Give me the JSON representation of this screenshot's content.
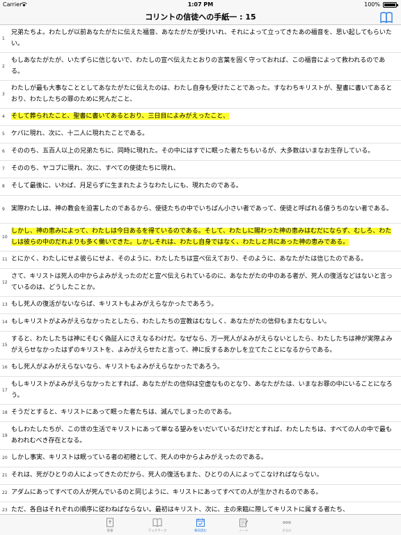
{
  "status": {
    "carrier": "Carrier",
    "time": "1:07 PM",
    "battery": "100%"
  },
  "header": {
    "title": "コリントの信徒への手紙一 : 15"
  },
  "verses": [
    {
      "n": "1",
      "text": "兄弟たちよ。わたしが以前あなたがたに伝えた福音、あなたがたが受けいれ、それによって立ってきたあの福音を、思い起してもらいたい。",
      "highlight": false
    },
    {
      "n": "2",
      "text": "もしあなたがたが、いたずらに信じないで、わたしの宣べ伝えたとおりの言葉を固く守っておれば、この福音によって救われるのである。",
      "highlight": false
    },
    {
      "n": "3",
      "text": "わたしが最も大事なこととしてあなたがたに伝えたのは、わたし自身も受けたことであった。すなわちキリストが、聖書に書いてあるとおり、わたしたちの罪のために死んだこと、",
      "highlight": false
    },
    {
      "n": "4",
      "text": "そして葬られたこと、聖書に書いてあるとおり、三日目によみがえったこと、",
      "highlight": true
    },
    {
      "n": "5",
      "text": "ケパに現れ、次に、十二人に現れたことである。",
      "highlight": false
    },
    {
      "n": "6",
      "text": "そののち、五百人以上の兄弟たちに、同時に現れた。その中にはすでに眠った者たちもいるが、大多数はいまなお生存している。",
      "highlight": false
    },
    {
      "n": "7",
      "text": "そののち、ヤコブに現れ、次に、すべての使徒たちに現れ、",
      "highlight": false
    },
    {
      "n": "8",
      "text": "そして最後に、いわば、月足らずに生まれたようなわたしにも、現れたのである。",
      "highlight": false
    },
    {
      "n": "9",
      "text": "実際わたしは、神の教会を迫害したのであるから、使徒たちの中でいちばん小さい者であって、使徒と呼ばれる値うちのない者である。",
      "highlight": false
    },
    {
      "n": "10",
      "text": "しかし、神の恵みによって、わたしは今日あるを得ているのである。そして、わたしに賜わった神の恵みはむだにならず、むしろ、わたしは彼らの中のだれよりも多く働いてきた。しかしそれは、わたし自身ではなく、わたしと共にあった神の恵みである。",
      "highlight": true
    },
    {
      "n": "11",
      "text": "とにかく、わたしにせよ彼らにせよ、そのように、わたしたちは宣べ伝えており、そのように、あなたがたは信じたのである。",
      "highlight": false
    },
    {
      "n": "12",
      "text": "さて、キリストは死人の中からよみがえったのだと宣べ伝えられているのに、あなたがたの中のある者が、死人の復活などはないと言っているのは、どうしたことか。",
      "highlight": false
    },
    {
      "n": "13",
      "text": "もし死人の復活がないならば、キリストもよみがえらなかったであろう。",
      "highlight": false
    },
    {
      "n": "14",
      "text": "もしキリストがよみがえらなかったとしたら、わたしたちの宣教はむなしく、あなたがたの信仰もまたむなしい。",
      "highlight": false
    },
    {
      "n": "15",
      "text": "すると、わたしたちは神にそむく偽証人にさえなるわけだ。なぜなら、万一死人がよみがえらないとしたら、わたしたちは神が実際よみがえらせなかったはずのキリストを、よみがえらせたと言って、神に反するあかしを立てたことになるからである。",
      "highlight": false
    },
    {
      "n": "16",
      "text": "もし死人がよみがえらないなら、キリストもよみがえらなかったであろう。",
      "highlight": false
    },
    {
      "n": "17",
      "text": "もしキリストがよみがえらなかったとすれば、あなたがたの信仰は空虚なものとなり、あなたがたは、いまなお罪の中にいることになろう。",
      "highlight": false
    },
    {
      "n": "18",
      "text": "そうだとすると、キリストにあって眠った者たちは、滅んでしまったのである。",
      "highlight": false
    },
    {
      "n": "19",
      "text": "もしわたしたちが、この世の生活でキリストにあって単なる望みをいだいているだけだとすれば、わたしたちは、すべての人の中で最もあわれむべき存在となる。",
      "highlight": false
    },
    {
      "n": "20",
      "text": "しかし事実、キリストは眠っている者の初穂として、死人の中からよみがえったのである。",
      "highlight": false
    },
    {
      "n": "21",
      "text": "それは、死がひとりの人によってきたのだから、死人の復活もまた、ひとりの人によってこなければならない。",
      "highlight": false
    },
    {
      "n": "22",
      "text": "アダムにあってすべての人が死んでいるのと同じように、キリストにあってすべての人が生かされるのである。",
      "highlight": false
    },
    {
      "n": "23",
      "text": "ただ、各自はそれぞれの順序に従わねばならない。最初はキリスト、次に、主の来臨に際してキリストに属する者たち、",
      "highlight": false
    }
  ],
  "tabs": [
    {
      "label": "聖書",
      "icon": "bible-icon"
    },
    {
      "label": "ブックマーク",
      "icon": "open-book-icon"
    },
    {
      "label": "毎日読む",
      "icon": "calendar-check-icon"
    },
    {
      "label": "ノート",
      "icon": "note-pencil-icon"
    },
    {
      "label": "さらに",
      "icon": "more-dots-icon"
    }
  ],
  "colors": {
    "accent": "#2f7de1",
    "highlight": "#ffff33",
    "inactive": "#8e8e8e"
  }
}
